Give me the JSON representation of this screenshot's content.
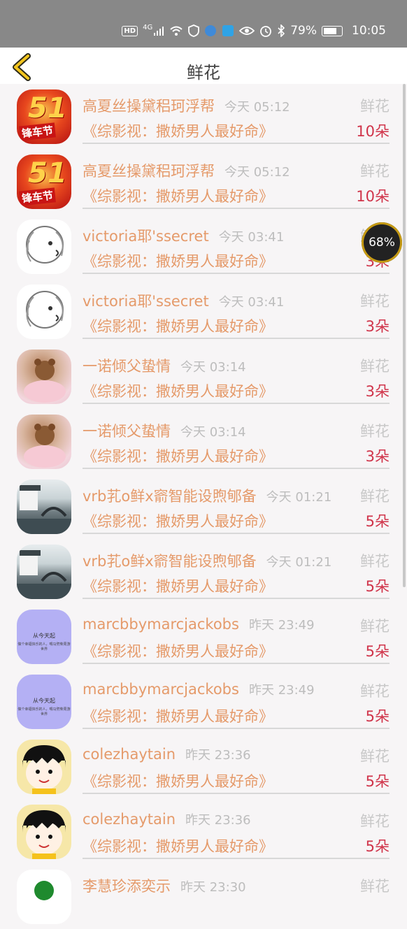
{
  "status_bar": {
    "hd": "HD",
    "network": "4G",
    "battery": "79%",
    "time": "10:05"
  },
  "header": {
    "title": "鲜花"
  },
  "rows": [
    {
      "name": "高夏丝操黛稆珂浮帮",
      "time": "今天 05:12",
      "gift": "鲜花",
      "book": "《综影视：撒娇男人最好命》",
      "count": "10朵",
      "avatar": "av-51"
    },
    {
      "name": "高夏丝操黛稆珂浮帮",
      "time": "今天 05:12",
      "gift": "鲜花",
      "book": "《综影视：撒娇男人最好命》",
      "count": "10朵",
      "avatar": "av-51"
    },
    {
      "name": "victoria耶'ssecret",
      "time": "今天 03:41",
      "gift": "鲜花",
      "book": "《综影视：撒娇男人最好命》",
      "count": "3朵",
      "avatar": "av-lion"
    },
    {
      "name": "victoria耶'ssecret",
      "time": "今天 03:41",
      "gift": "鲜花",
      "book": "《综影视：撒娇男人最好命》",
      "count": "3朵",
      "avatar": "av-lion"
    },
    {
      "name": "一诺倾父蛰情",
      "time": "今天 03:14",
      "gift": "鲜花",
      "book": "《综影视：撒娇男人最好命》",
      "count": "3朵",
      "avatar": "av-girl"
    },
    {
      "name": "一诺倾父蛰情",
      "time": "今天 03:14",
      "gift": "鲜花",
      "book": "《综影视：撒娇男人最好命》",
      "count": "3朵",
      "avatar": "av-girl"
    },
    {
      "name": "vrb芤o鲜x窬智能设煦郇备",
      "time": "今天 01:21",
      "gift": "鲜花",
      "book": "《综影视：撒娇男人最好命》",
      "count": "5朵",
      "avatar": "av-town"
    },
    {
      "name": "vrb芤o鲜x窬智能设煦郇备",
      "time": "今天 01:21",
      "gift": "鲜花",
      "book": "《综影视：撒娇男人最好命》",
      "count": "5朵",
      "avatar": "av-town"
    },
    {
      "name": "marcbbymarcjackobs",
      "time": "昨天 23:49",
      "gift": "鲜花",
      "book": "《综影视：撒娇男人最好命》",
      "count": "5朵",
      "avatar": "av-purple",
      "avatar_text": "从今天起",
      "avatar_subtext": "做个幸福快乐的人，喂马劈柴周游世界"
    },
    {
      "name": "marcbbymarcjackobs",
      "time": "昨天 23:49",
      "gift": "鲜花",
      "book": "《综影视：撒娇男人最好命》",
      "count": "5朵",
      "avatar": "av-purple",
      "avatar_text": "从今天起",
      "avatar_subtext": "做个幸福快乐的人，喂马劈柴周游世界"
    },
    {
      "name": "colezhaytain",
      "time": "昨天 23:36",
      "gift": "鲜花",
      "book": "《综影视：撒娇男人最好命》",
      "count": "5朵",
      "avatar": "av-maruko"
    },
    {
      "name": "colezhaytain",
      "time": "昨天 23:36",
      "gift": "鲜花",
      "book": "《综影视：撒娇男人最好命》",
      "count": "5朵",
      "avatar": "av-maruko"
    },
    {
      "name": "李慧珍添奕示",
      "time": "昨天 23:30",
      "gift": "鲜花",
      "book": "",
      "count": "",
      "avatar": "av-green"
    }
  ],
  "avatar_51": {
    "big": "51",
    "text": "锋车节"
  },
  "float_badge": "68%"
}
